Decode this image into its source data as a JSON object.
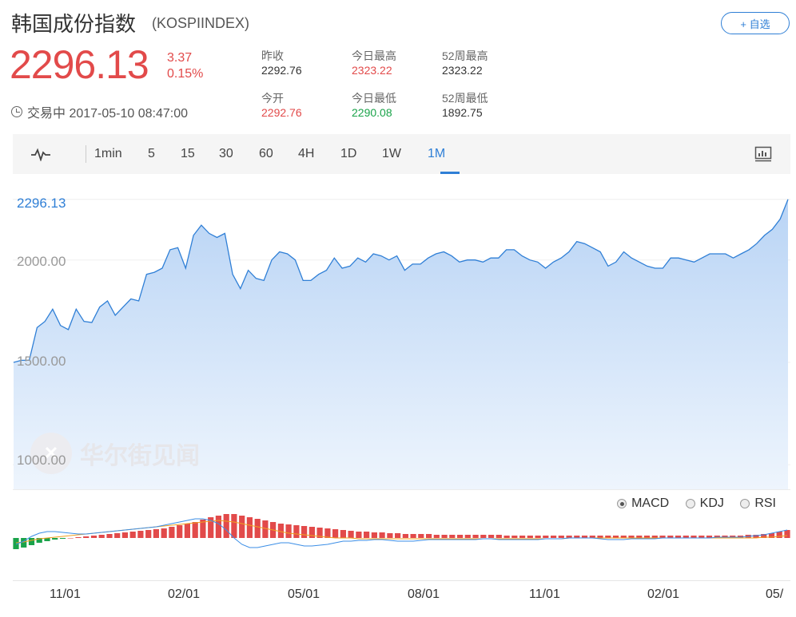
{
  "header": {
    "title": "韩国成份指数",
    "code": "(KOSPIINDEX)",
    "add_button": "+ 自选"
  },
  "quote": {
    "price": "2296.13",
    "change": "3.37",
    "change_pct": "0.15%",
    "status": "交易中 2017-05-10 08:47:00"
  },
  "stats": {
    "prev_close_label": "昨收",
    "prev_close": "2292.76",
    "open_label": "今开",
    "open": "2292.76",
    "day_high_label": "今日最高",
    "day_high": "2323.22",
    "day_low_label": "今日最低",
    "day_low": "2290.08",
    "wk52_high_label": "52周最高",
    "wk52_high": "2323.22",
    "wk52_low_label": "52周最低",
    "wk52_low": "1892.75"
  },
  "toolbar": {
    "intervals": [
      "1min",
      "5",
      "15",
      "30",
      "60",
      "4H",
      "1D",
      "1W",
      "1M"
    ],
    "active": "1M"
  },
  "indicators": {
    "options": [
      "MACD",
      "KDJ",
      "RSI"
    ],
    "selected": "MACD"
  },
  "watermark": "华尔街见闻",
  "colors": {
    "accent": "#2f7fd6",
    "up": "#e24a4a",
    "down": "#1aa34a",
    "line": "#2f7fd6"
  },
  "chart_data": {
    "type": "area",
    "current_label": "2296.13",
    "y_ticks": [
      2000.0,
      1500.0,
      1000.0
    ],
    "y_tick_labels": [
      "2000.00",
      "1500.00",
      "1000.00"
    ],
    "ylim": [
      880,
      2420
    ],
    "x_tick_labels": [
      "11/01",
      "02/01",
      "05/01",
      "08/01",
      "11/01",
      "02/01",
      "05/"
    ],
    "values": [
      1500,
      1510,
      1510,
      1670,
      1700,
      1760,
      1680,
      1660,
      1760,
      1700,
      1695,
      1770,
      1800,
      1730,
      1770,
      1810,
      1800,
      1930,
      1940,
      1960,
      2050,
      2060,
      1960,
      2120,
      2170,
      2130,
      2110,
      2130,
      1930,
      1860,
      1950,
      1910,
      1900,
      2000,
      2040,
      2030,
      2000,
      1900,
      1900,
      1930,
      1950,
      2010,
      1960,
      1970,
      2010,
      1990,
      2030,
      2020,
      2000,
      2020,
      1950,
      1980,
      1980,
      2010,
      2030,
      2040,
      2020,
      1990,
      2000,
      2000,
      1990,
      2010,
      2010,
      2050,
      2050,
      2020,
      2000,
      1990,
      1960,
      1990,
      2010,
      2040,
      2090,
      2080,
      2060,
      2040,
      1970,
      1990,
      2040,
      2010,
      1990,
      1970,
      1960,
      1960,
      2010,
      2010,
      2000,
      1990,
      2010,
      2030,
      2030,
      2030,
      2010,
      2030,
      2050,
      2080,
      2120,
      2150,
      2200,
      2296
    ]
  },
  "macd_data": {
    "type": "bar",
    "histogram": [
      -14,
      -12,
      -9,
      -6,
      -4,
      -2,
      -1,
      0,
      1,
      2,
      3,
      4,
      5,
      6,
      7,
      8,
      9,
      10,
      11,
      12,
      14,
      16,
      18,
      20,
      23,
      26,
      28,
      30,
      30,
      28,
      26,
      24,
      22,
      20,
      18,
      17,
      16,
      15,
      14,
      13,
      12,
      11,
      10,
      9,
      8,
      8,
      7,
      7,
      6,
      6,
      5,
      5,
      5,
      5,
      4,
      4,
      4,
      4,
      4,
      4,
      4,
      4,
      4,
      3,
      3,
      3,
      3,
      3,
      3,
      3,
      3,
      3,
      3,
      3,
      3,
      3,
      3,
      3,
      3,
      3,
      3,
      3,
      3,
      3,
      3,
      3,
      3,
      3,
      3,
      3,
      3,
      3,
      3,
      3,
      4,
      4,
      5,
      6,
      8,
      10
    ],
    "dif": [
      -8,
      -4,
      2,
      6,
      8,
      8,
      7,
      6,
      5,
      5,
      6,
      7,
      8,
      9,
      10,
      11,
      12,
      13,
      14,
      16,
      18,
      20,
      22,
      24,
      24,
      22,
      18,
      10,
      0,
      -8,
      -12,
      -12,
      -10,
      -8,
      -6,
      -6,
      -8,
      -10,
      -10,
      -9,
      -8,
      -6,
      -4,
      -4,
      -3,
      -3,
      -2,
      -2,
      -3,
      -4,
      -4,
      -4,
      -3,
      -2,
      -2,
      -2,
      -2,
      -2,
      -2,
      -2,
      -1,
      -1,
      -2,
      -2,
      -2,
      -2,
      -2,
      -2,
      -1,
      -1,
      -1,
      0,
      0,
      0,
      0,
      -1,
      -2,
      -2,
      -2,
      -1,
      -1,
      -1,
      -1,
      0,
      0,
      0,
      0,
      0,
      0,
      0,
      1,
      1,
      1,
      1,
      2,
      3,
      4,
      6,
      8,
      10
    ],
    "dea": [
      -6,
      -5,
      -3,
      -1,
      0,
      1,
      2,
      3,
      4,
      5,
      6,
      7,
      8,
      9,
      10,
      11,
      12,
      13,
      14,
      15,
      16,
      17,
      18,
      19,
      20,
      21,
      22,
      21,
      20,
      18,
      16,
      14,
      12,
      10,
      8,
      6,
      5,
      4,
      3,
      2,
      1,
      0,
      0,
      0,
      -1,
      -1,
      -1,
      -1,
      -1,
      -1,
      -1,
      -1,
      -1,
      -1,
      -1,
      -1,
      -1,
      -1,
      -1,
      -1,
      -1,
      -1,
      -1,
      -1,
      -1,
      -1,
      -1,
      -1,
      -1,
      -1,
      -1,
      0,
      0,
      0,
      0,
      0,
      0,
      0,
      0,
      0,
      0,
      0,
      0,
      0,
      0,
      0,
      0,
      0,
      0,
      0,
      0,
      0,
      0,
      0,
      0,
      0,
      1,
      1,
      2,
      3
    ]
  }
}
